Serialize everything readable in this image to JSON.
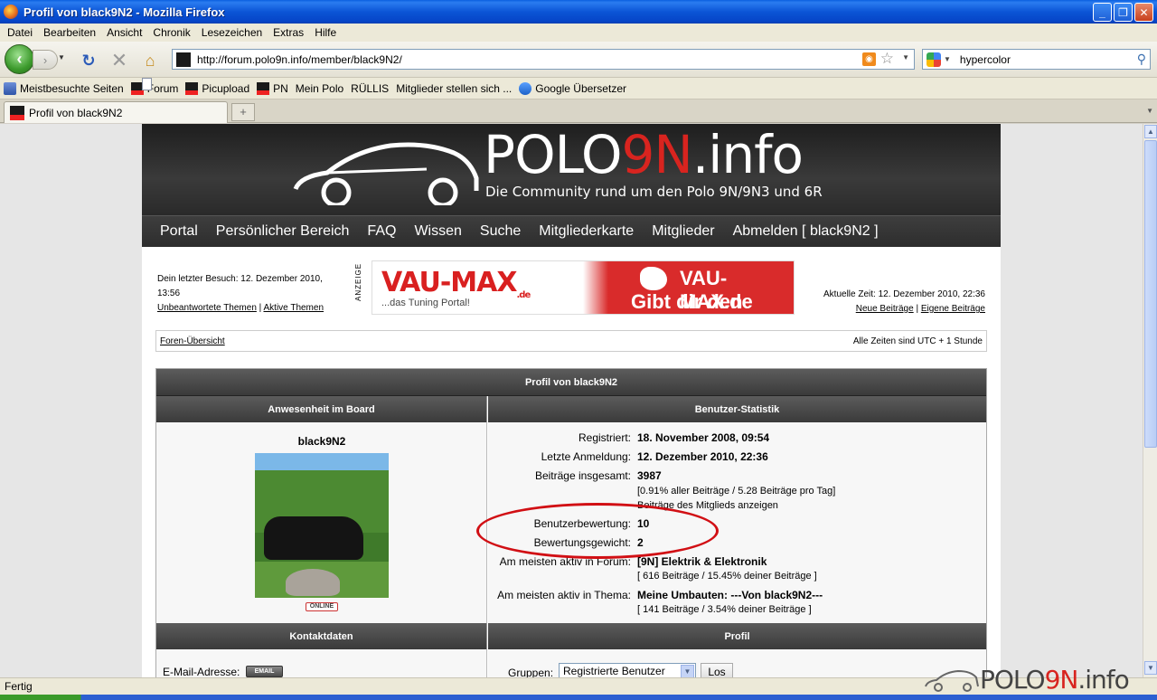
{
  "window": {
    "title": "Profil von black9N2 - Mozilla Firefox"
  },
  "menu": [
    "Datei",
    "Bearbeiten",
    "Ansicht",
    "Chronik",
    "Lesezeichen",
    "Extras",
    "Hilfe"
  ],
  "toolbar": {
    "url": "http://forum.polo9n.info/member/black9N2/",
    "search_value": "hypercolor"
  },
  "bookmarks": [
    "Meistbesuchte Seiten",
    "Forum",
    "Picupload",
    "PN",
    "Mein Polo",
    "RÜLLIS",
    "Mitglieder stellen sich ...",
    "Google Übersetzer"
  ],
  "tab": {
    "title": "Profil von black9N2"
  },
  "site": {
    "logo_prefix": "POLO",
    "logo_nine": "9N",
    "logo_suffix": ".info",
    "tagline": "Die Community rund um den Polo 9N/9N3 und 6R",
    "nav": [
      "Portal",
      "Persönlicher Bereich",
      "FAQ",
      "Wissen",
      "Suche",
      "Mitgliederkarte",
      "Mitglieder",
      "Abmelden [ black9N2 ]"
    ]
  },
  "info": {
    "last_visit": "Dein letzter Besuch: 12. Dezember 2010, 13:56",
    "unanswered": "Unbeantwortete Themen",
    "active": "Aktive Themen",
    "current_time": "Aktuelle Zeit: 12. Dezember 2010, 22:36",
    "new_posts": "Neue Beiträge",
    "own_posts": "Eigene Beiträge",
    "ad_label": "ANZEIGE"
  },
  "banner": {
    "brand": "VAU-MAX",
    "brand_tld": ".de",
    "slogan": "...das Tuning Portal!",
    "right_line1": "VAU-MAX.de",
    "right_line2": "Gibt dir den Klick!"
  },
  "breadcrumb": {
    "home": "Foren-Übersicht",
    "tz": "Alle Zeiten sind UTC + 1 Stunde"
  },
  "profile": {
    "title": "Profil von black9N2",
    "col_left": "Anwesenheit im Board",
    "col_right": "Benutzer-Statistik",
    "username": "black9N2",
    "online_badge": "ONLINE",
    "stats": [
      {
        "label": "Registriert:",
        "value": "18. November 2008, 09:54"
      },
      {
        "label": "Letzte Anmeldung:",
        "value": "12. Dezember 2010, 22:36"
      },
      {
        "label": "Beiträge insgesamt:",
        "value": "3987"
      },
      {
        "label": "Benutzerbewertung:",
        "value": "10"
      },
      {
        "label": "Bewertungsgewicht:",
        "value": "2"
      },
      {
        "label": "Am meisten aktiv in Forum:",
        "value": "[9N] Elektrik & Elektronik"
      },
      {
        "label": "Am meisten aktiv in Thema:",
        "value": "Meine Umbauten: ---Von black9N2---"
      }
    ],
    "posts_detail": "[0.91% aller Beiträge / 5.28 Beiträge pro Tag]",
    "posts_link": "Beiträge des Mitglieds anzeigen",
    "forum_detail": "[ 616 Beiträge / 15.45% deiner Beiträge ]",
    "topic_detail": "[ 141 Beiträge / 3.54% deiner Beiträge ]",
    "contact_header": "Kontaktdaten",
    "profile_header": "Profil",
    "email_label": "E-Mail-Adresse:",
    "email_button": "EMAIL",
    "groups_label": "Gruppen:",
    "groups_selected": "Registrierte Benutzer",
    "go_button": "Los"
  },
  "status": {
    "text": "Fertig"
  },
  "watermark": {
    "prefix": "POLO",
    "nine": "9N",
    "suffix": ".info"
  },
  "colors": {
    "accent_red": "#d8241f",
    "header_dark": "#2a2a2a",
    "xp_blue": "#0b55d6"
  }
}
